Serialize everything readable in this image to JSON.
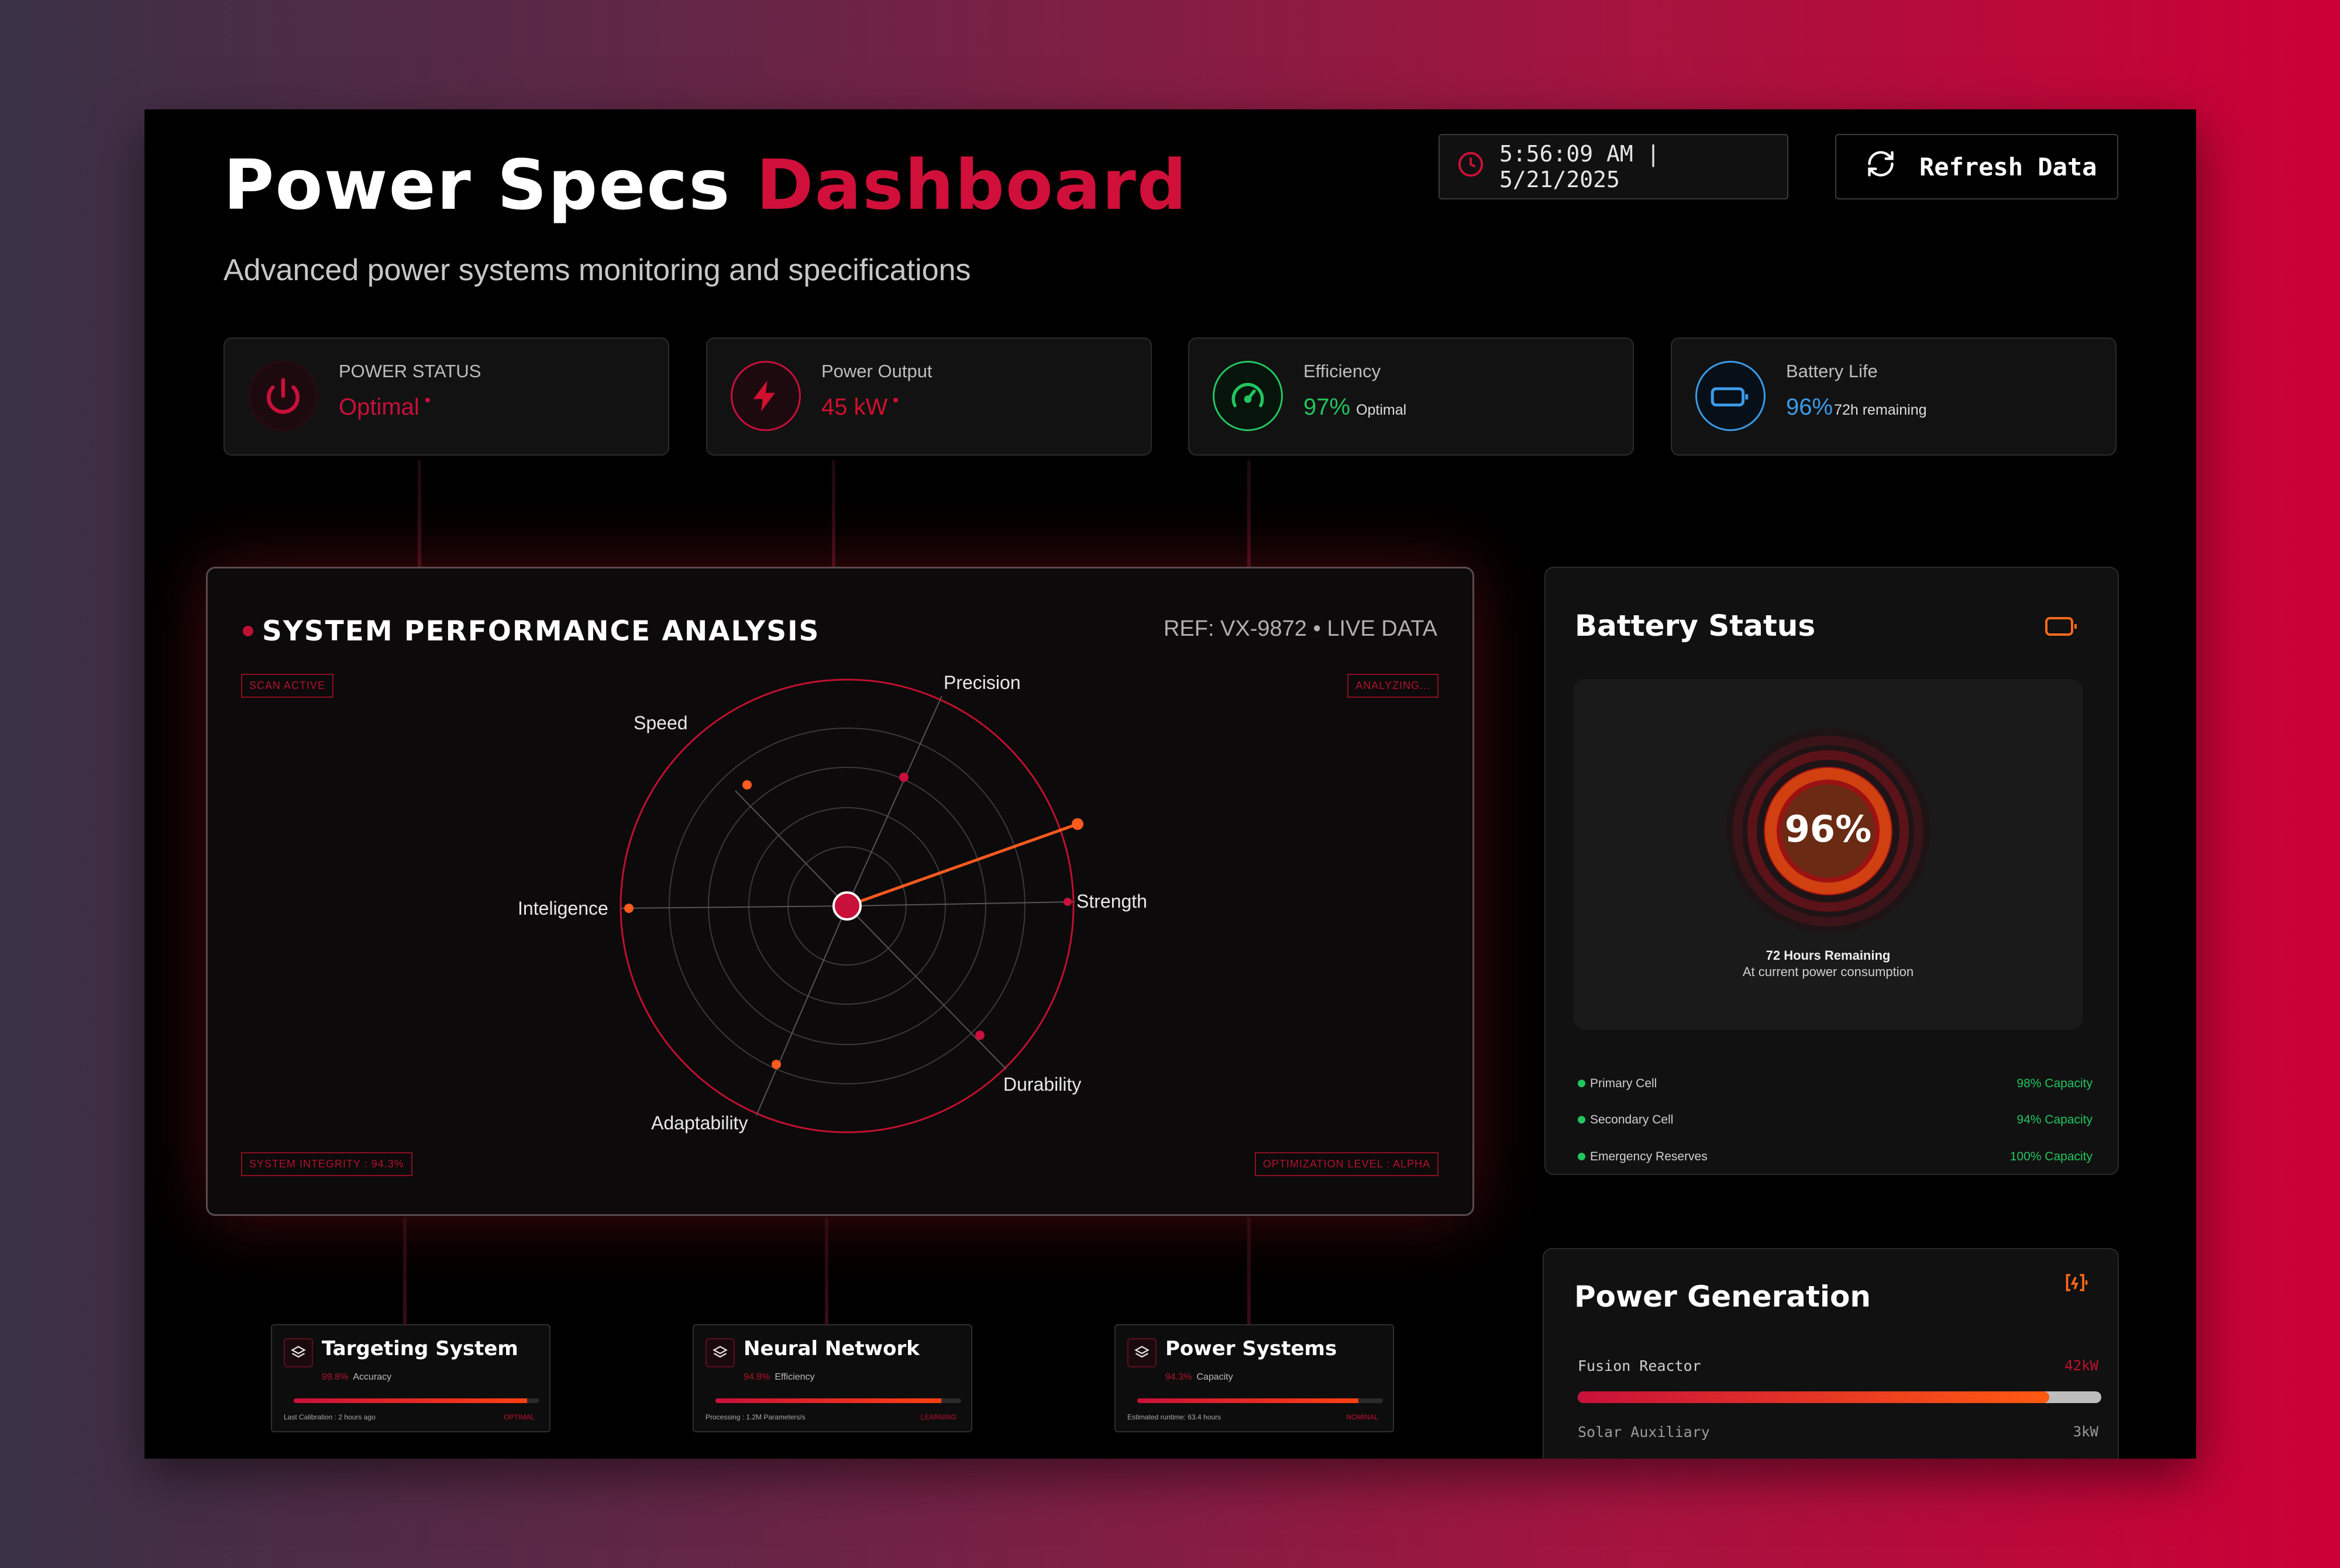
{
  "header": {
    "title_main": "Power Specs",
    "title_accent": "Dashboard",
    "subtitle": "Advanced power systems monitoring and specifications",
    "clock_text": "5:56:09 AM | 5/21/2025",
    "refresh_label": "Refresh Data"
  },
  "stats": [
    {
      "label": "POWER STATUS",
      "value": "Optimal",
      "color": "#c8103a",
      "icon": "power-icon"
    },
    {
      "label": "Power Output",
      "value": "45 kW",
      "color": "#d0102f",
      "icon": "lightning-icon"
    },
    {
      "label": "Efficiency",
      "value": "97%",
      "note": "Optimal",
      "color": "#22c55e",
      "icon": "speedometer-icon"
    },
    {
      "label": "Battery Life",
      "value": "96%",
      "note": "72h remaining",
      "color": "#3b9be8",
      "icon": "battery-icon"
    }
  ],
  "performance": {
    "title": "SYSTEM PERFORMANCE ANALYSIS",
    "ref": "REF: VX-9872 • LIVE DATA",
    "tag_scan": "SCAN ACTIVE",
    "tag_analyzing": "ANALYZING...",
    "tag_integrity": "SYSTEM INTEGRITY : 94.3%",
    "tag_optimization": "OPTIMIZATION LEVEL : ALPHA",
    "axes": [
      "Precision",
      "Strength",
      "Durability",
      "Adaptability",
      "Inteligence",
      "Speed"
    ]
  },
  "battery": {
    "title": "Battery Status",
    "percent": "96%",
    "remaining": "72 Hours Remaining",
    "consumption": "At current power consumption",
    "cells": [
      {
        "name": "Primary Cell",
        "capacity": "98% Capacity"
      },
      {
        "name": "Secondary Cell",
        "capacity": "94% Capacity"
      },
      {
        "name": "Emergency Reserves",
        "capacity": "100% Capacity"
      }
    ]
  },
  "generation": {
    "title": "Power Generation",
    "rows": [
      {
        "label": "Fusion Reactor",
        "value": "42kW",
        "fraction": 0.9
      }
    ],
    "next_label": "Solar Auxiliary",
    "next_value": "3kW"
  },
  "modules": [
    {
      "name": "Targeting System",
      "metric_value": "99.8%",
      "metric_label": "Accuracy",
      "foot": "Last Calibration : 2 hours ago",
      "state": "OPTIMAL",
      "fraction": 0.95
    },
    {
      "name": "Neural Network",
      "metric_value": "94.8%",
      "metric_label": "Efficiency",
      "foot": "Processing : 1.2M Parameters/s",
      "state": "LEARNING",
      "fraction": 0.92
    },
    {
      "name": "Power Systems",
      "metric_value": "94.3%",
      "metric_label": "Capacity",
      "foot": "Estimated runtime: 63.4 hours",
      "state": "NOMINAL",
      "fraction": 0.9
    }
  ]
}
